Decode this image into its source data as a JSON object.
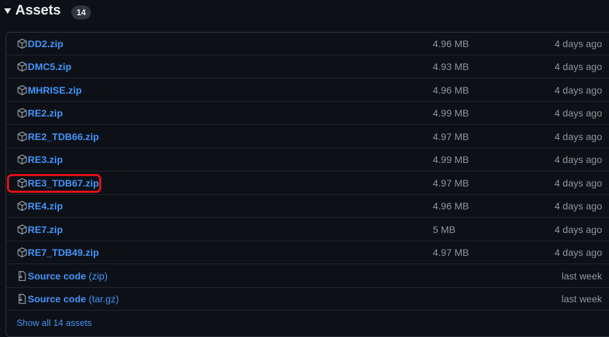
{
  "header": {
    "title": "Assets",
    "count": "14"
  },
  "assets": [
    {
      "name": "DD2.zip",
      "size": "4.96 MB",
      "date": "4 days ago"
    },
    {
      "name": "DMC5.zip",
      "size": "4.93 MB",
      "date": "4 days ago"
    },
    {
      "name": "MHRISE.zip",
      "size": "4.96 MB",
      "date": "4 days ago"
    },
    {
      "name": "RE2.zip",
      "size": "4.99 MB",
      "date": "4 days ago"
    },
    {
      "name": "RE2_TDB66.zip",
      "size": "4.97 MB",
      "date": "4 days ago"
    },
    {
      "name": "RE3.zip",
      "size": "4.99 MB",
      "date": "4 days ago"
    },
    {
      "name": "RE3_TDB67.zip",
      "size": "4.97 MB",
      "date": "4 days ago"
    },
    {
      "name": "RE4.zip",
      "size": "4.96 MB",
      "date": "4 days ago"
    },
    {
      "name": "RE7.zip",
      "size": "5 MB",
      "date": "4 days ago"
    },
    {
      "name": "RE7_TDB49.zip",
      "size": "4.97 MB",
      "date": "4 days ago"
    }
  ],
  "source": [
    {
      "name": "Source code",
      "format": "(zip)",
      "date": "last week"
    },
    {
      "name": "Source code",
      "format": "(tar.gz)",
      "date": "last week"
    }
  ],
  "footer": {
    "show_all": "Show all 14 assets"
  },
  "colors": {
    "background": "#0d1117",
    "link": "#4493f8",
    "muted": "#8d96a0",
    "border": "#30363d",
    "highlight": "#e3101a"
  },
  "icons": {
    "asset": "package-icon",
    "source": "file-zip-icon",
    "toggle": "triangle-down-icon"
  }
}
